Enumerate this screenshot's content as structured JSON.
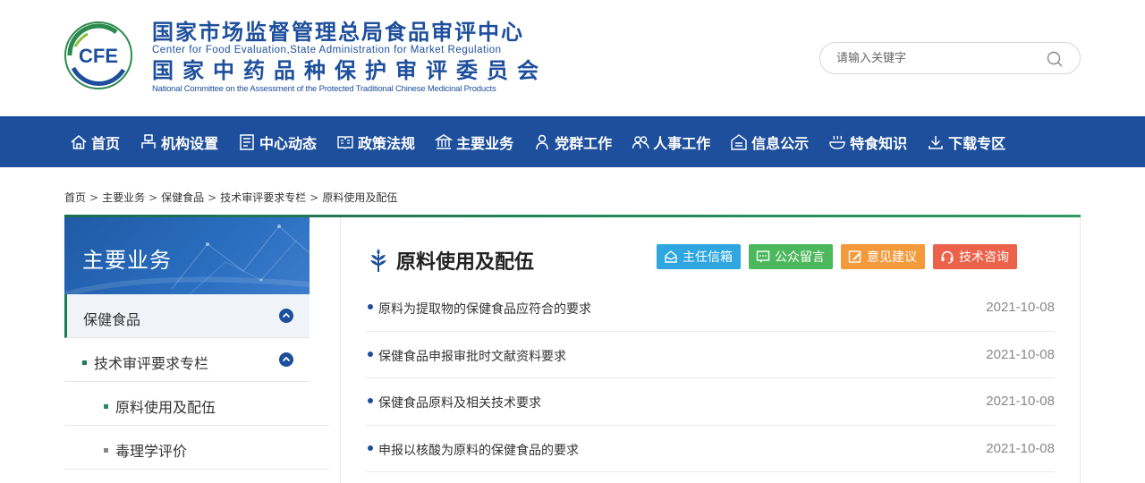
{
  "header": {
    "logo_text": "CFE",
    "title_cn_1": "国家市场监督管理总局食品审评中心",
    "title_en_1": "Center for Food Evaluation,State Administration for Market Regulation",
    "title_cn_2": "国家中药品种保护审评委员会",
    "title_en_2": "National Committee on the Assessment of the Protected Traditional Chinese Medicinal Products"
  },
  "search": {
    "placeholder": "请输入关键字",
    "icon": "search-icon"
  },
  "nav": {
    "items": [
      {
        "label": "首页",
        "icon": "home-icon"
      },
      {
        "label": "机构设置",
        "icon": "org-chart-icon"
      },
      {
        "label": "中心动态",
        "icon": "news-icon"
      },
      {
        "label": "政策法规",
        "icon": "policy-icon"
      },
      {
        "label": "主要业务",
        "icon": "bank-icon"
      },
      {
        "label": "党群工作",
        "icon": "person-icon"
      },
      {
        "label": "人事工作",
        "icon": "people-icon"
      },
      {
        "label": "信息公示",
        "icon": "notice-icon"
      },
      {
        "label": "特食知识",
        "icon": "food-icon"
      },
      {
        "label": "下载专区",
        "icon": "download-icon"
      }
    ]
  },
  "breadcrumb": {
    "items": [
      "首页",
      "主要业务",
      "保健食品",
      "技术审评要求专栏",
      "原料使用及配伍"
    ],
    "separator": ">"
  },
  "sidebar": {
    "title": "主要业务",
    "items": [
      {
        "label": "保健食品",
        "level": 1,
        "expanded": true
      },
      {
        "label": "技术审评要求专栏",
        "level": 2,
        "expanded": true
      },
      {
        "label": "原料使用及配伍",
        "level": 3,
        "active": true
      },
      {
        "label": "毒理学评价",
        "level": 3
      }
    ]
  },
  "main": {
    "title": "原料使用及配伍",
    "actions": [
      {
        "label": "主任信箱",
        "icon": "mailbox-icon",
        "color": "#2fa6e0"
      },
      {
        "label": "公众留言",
        "icon": "message-icon",
        "color": "#4cb85c"
      },
      {
        "label": "意见建议",
        "icon": "edit-icon",
        "color": "#f39a3c"
      },
      {
        "label": "技术咨询",
        "icon": "headset-icon",
        "color": "#ec6149"
      }
    ],
    "articles": [
      {
        "title": "原料为提取物的保健食品应符合的要求",
        "date": "2021-10-08"
      },
      {
        "title": "保健食品申报审批时文献资料要求",
        "date": "2021-10-08"
      },
      {
        "title": "保健食品原料及相关技术要求",
        "date": "2021-10-08"
      },
      {
        "title": "申报以核酸为原料的保健食品的要求",
        "date": "2021-10-08"
      }
    ]
  },
  "colors": {
    "brand_blue": "#1d4f9c",
    "accent_green": "#1b7a55"
  }
}
